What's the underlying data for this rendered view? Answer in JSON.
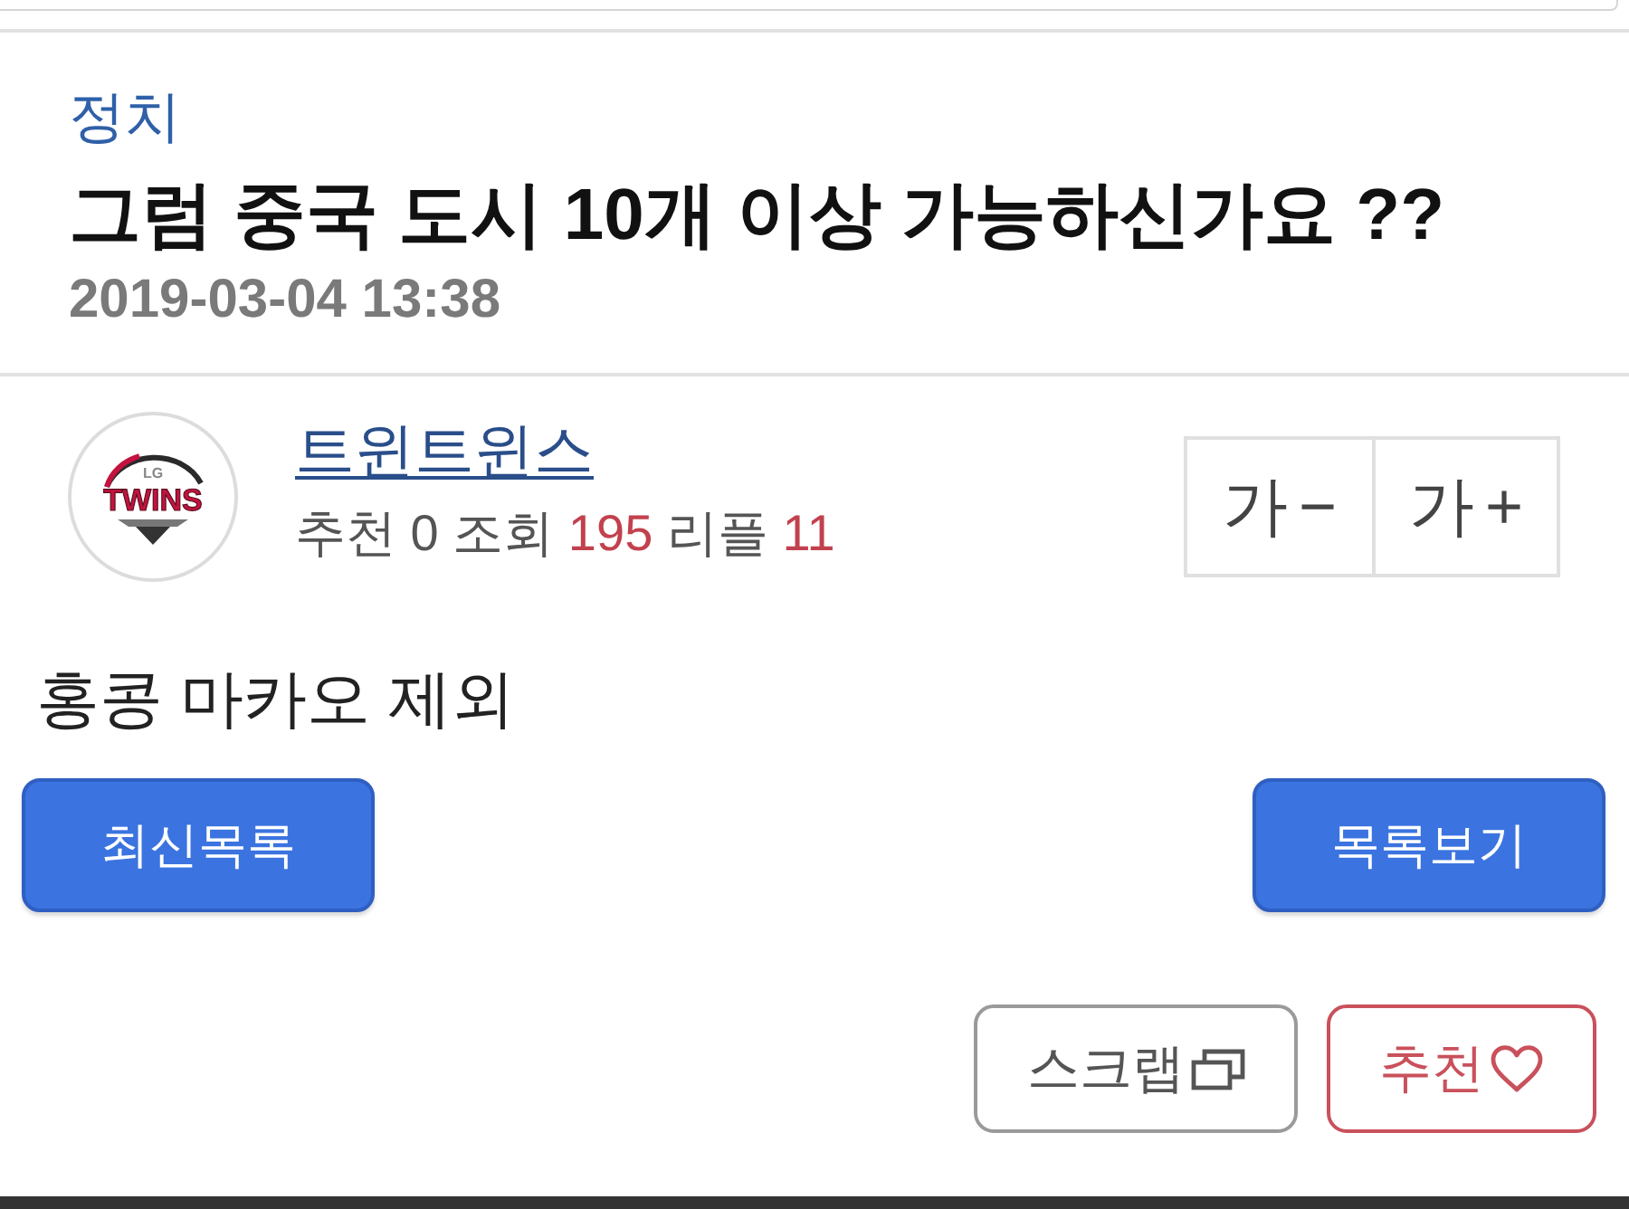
{
  "post": {
    "category": "정치",
    "title": "그럼 중국 도시 10개 이상 가능하신가요 ??",
    "date": "2019-03-04 13:38"
  },
  "author": {
    "logo": {
      "small": "LG",
      "large": "TWINS"
    },
    "name": "트윈트윈스",
    "stats": [
      {
        "label": "추천",
        "value": "0",
        "highlight": false
      },
      {
        "label": "조회",
        "value": "195",
        "highlight": true
      },
      {
        "label": "리플",
        "value": "11",
        "highlight": true
      }
    ]
  },
  "font_size_buttons": [
    {
      "label": "가",
      "sign": "−"
    },
    {
      "label": "가",
      "sign": "+"
    }
  ],
  "body": "홍콩 마카오 제외",
  "nav_buttons": [
    {
      "label": "최신목록"
    },
    {
      "label": "목록보기"
    }
  ],
  "actions": [
    {
      "label": "스크랩",
      "kind": "scrap"
    },
    {
      "label": "추천",
      "kind": "recommend"
    }
  ]
}
